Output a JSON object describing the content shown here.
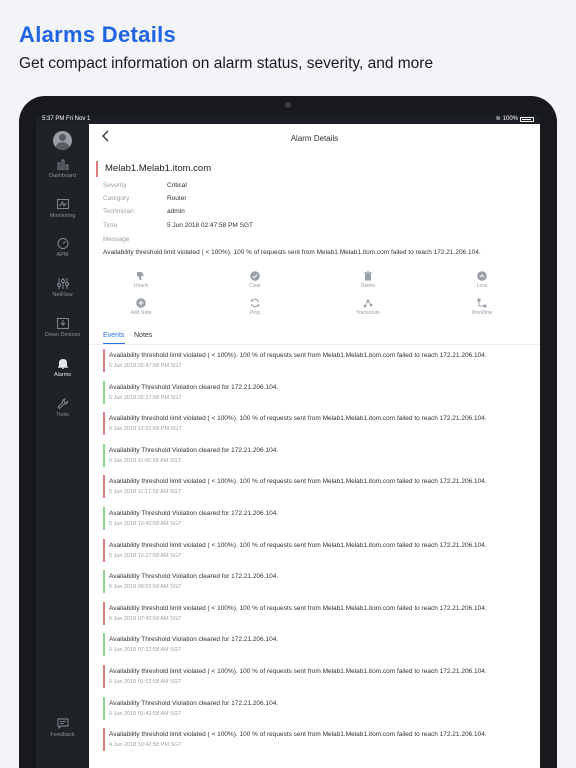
{
  "promo": {
    "title": "Alarms Details",
    "subtitle": "Get compact information on alarm status, severity, and more"
  },
  "statusbar": {
    "time": "5:37 PM   Fri Nov 1",
    "battery": "100%"
  },
  "sidebar": {
    "items": [
      {
        "label": "Dashboard",
        "icon": "bar-chart-icon"
      },
      {
        "label": "Monitoring",
        "icon": "monitor-pulse-icon"
      },
      {
        "label": "APM",
        "icon": "gauge-icon"
      },
      {
        "label": "NetFlow",
        "icon": "sliders-icon"
      },
      {
        "label": "Down Devices",
        "icon": "download-tray-icon"
      },
      {
        "label": "Alarms",
        "icon": "bell-icon"
      },
      {
        "label": "Tools",
        "icon": "wrench-icon"
      }
    ],
    "feedback": "Feedback"
  },
  "header": {
    "title": "Alarm Details"
  },
  "alarm": {
    "node": "Melab1.Melab1.itom.com",
    "properties": [
      {
        "label": "Severity",
        "value": "Critical"
      },
      {
        "label": "Category",
        "value": "Router"
      },
      {
        "label": "Technician",
        "value": "admin"
      },
      {
        "label": "Time",
        "value": "5 Jun 2018 02:47:58 PM SGT"
      },
      {
        "label": "Message",
        "value": ""
      }
    ],
    "message": "Availability threshold limit violated ( < 100%).  100 % of requests sent from Melab1.Melab1.itom.com failed to reach 172.21.206.104."
  },
  "actions": {
    "row1": [
      "Unack",
      "Clear",
      "Delete",
      "Less"
    ],
    "row2": [
      "Add Note",
      "Ping",
      "Traceroute",
      "Workflow"
    ]
  },
  "tabs": {
    "events": "Events",
    "notes": "Notes"
  },
  "colors": {
    "critical": "#e07b80",
    "clear": "#8fd48f",
    "accent": "#2a6fe8"
  },
  "events": [
    {
      "title": "Availability threshold limit violated ( < 100%).  100 % of requests sent from Melab1.Melab1.itom.com failed to reach 172.21.206.104.",
      "time": "5 Jun 2018 02:47:58 PM SGT",
      "status": "critical"
    },
    {
      "title": "Availability Threshold Violation cleared for 172.21.206.104.",
      "time": "5 Jun 2018 02:17:58 PM SGT",
      "status": "clear"
    },
    {
      "title": "Availability threshold limit violated ( < 100%).  100 % of requests sent from Melab1.Melab1.itom.com failed to reach 172.21.206.104.",
      "time": "5 Jun 2018 12:02:58 PM SGT",
      "status": "critical"
    },
    {
      "title": "Availability Threshold Violation cleared for 172.21.206.104.",
      "time": "5 Jun 2018 11:42:58 AM SGT",
      "status": "clear"
    },
    {
      "title": "Availability threshold limit violated ( < 100%).  100 % of requests sent from Melab1.Melab1.itom.com failed to reach 172.21.206.104.",
      "time": "5 Jun 2018 11:17:58 AM SGT",
      "status": "critical"
    },
    {
      "title": "Availability Threshold Violation cleared for 172.21.206.104.",
      "time": "5 Jun 2018 10:42:58 AM SGT",
      "status": "clear"
    },
    {
      "title": "Availability threshold limit violated ( < 100%).  100 % of requests sent from Melab1.Melab1.itom.com failed to reach 172.21.206.104.",
      "time": "5 Jun 2018 10:27:58 AM SGT",
      "status": "critical"
    },
    {
      "title": "Availability Threshold Violation cleared for 172.21.206.104.",
      "time": "5 Jun 2018 09:52:58 AM SGT",
      "status": "clear"
    },
    {
      "title": "Availability threshold limit violated ( < 100%).  100 % of requests sent from Melab1.Melab1.itom.com failed to reach 172.21.206.104.",
      "time": "5 Jun 2018 07:42:58 AM SGT",
      "status": "critical"
    },
    {
      "title": "Availability Threshold Violation cleared for 172.21.206.104.",
      "time": "5 Jun 2018 07:32:58 AM SGT",
      "status": "clear"
    },
    {
      "title": "Availability threshold limit violated ( < 100%).  100 % of requests sent from Melab1.Melab1.itom.com failed to reach 172.21.206.104.",
      "time": "5 Jun 2018 01:52:58 AM SGT",
      "status": "critical"
    },
    {
      "title": "Availability Threshold Violation cleared for 172.21.206.104.",
      "time": "5 Jun 2018 01:42:58 AM SGT",
      "status": "clear"
    },
    {
      "title": "Availability threshold limit violated ( < 100%).  100 % of requests sent from Melab1.Melab1.itom.com failed to reach 172.21.206.104.",
      "time": "4 Jun 2018 10:42:58 PM SGT",
      "status": "critical"
    }
  ]
}
